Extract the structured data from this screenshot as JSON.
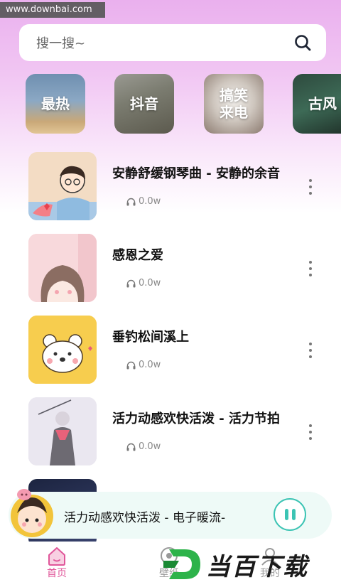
{
  "watermark_top": "www.downbai.com",
  "search": {
    "placeholder": "搜一搜~"
  },
  "categories": [
    {
      "label": "最热"
    },
    {
      "label": "抖音"
    },
    {
      "label": "搞笑\n来电"
    },
    {
      "label": "古风"
    }
  ],
  "songs": [
    {
      "title": "安静舒缓钢琴曲 - 安静的余音",
      "plays": "0.0w"
    },
    {
      "title": "感恩之爱",
      "plays": "0.0w"
    },
    {
      "title": "垂钓松间溪上",
      "plays": "0.0w"
    },
    {
      "title": "活力动感欢快活泼 - 活力节拍",
      "plays": "0.0w"
    },
    {
      "title": "",
      "plays": ""
    }
  ],
  "player": {
    "title": "活力动感欢快活泼 - 电子暖流-"
  },
  "tabs": [
    {
      "label": "首页"
    },
    {
      "label": "壁纸"
    },
    {
      "label": "我的"
    }
  ],
  "brand_watermark": "当百下载",
  "colors": {
    "accent": "#e0569a",
    "play_teal": "#3cc4b4"
  }
}
